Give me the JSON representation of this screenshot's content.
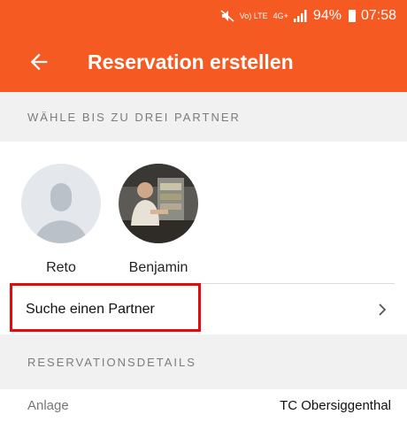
{
  "status_bar": {
    "volte": "Vo) LTE",
    "network": "4G+",
    "battery": "94%",
    "time": "07:58",
    "icons": [
      "mute-icon",
      "signal-icon",
      "battery-icon"
    ]
  },
  "app_bar": {
    "title": "Reservation erstellen",
    "back_icon": "arrow-left-icon",
    "color": "#f45a22"
  },
  "partners_section": {
    "header": "WÄHLE BIS ZU DREI PARTNER",
    "partners": [
      {
        "name": "Reto",
        "avatar": "default-avatar"
      },
      {
        "name": "Benjamin",
        "avatar": "photo-avatar"
      }
    ],
    "search_label": "Suche einen Partner",
    "chevron_icon": "chevron-right-icon"
  },
  "details_section": {
    "header": "RESERVATIONSDETAILS",
    "rows": [
      {
        "label": "Anlage",
        "value": "TC Obersiggenthal"
      }
    ]
  }
}
